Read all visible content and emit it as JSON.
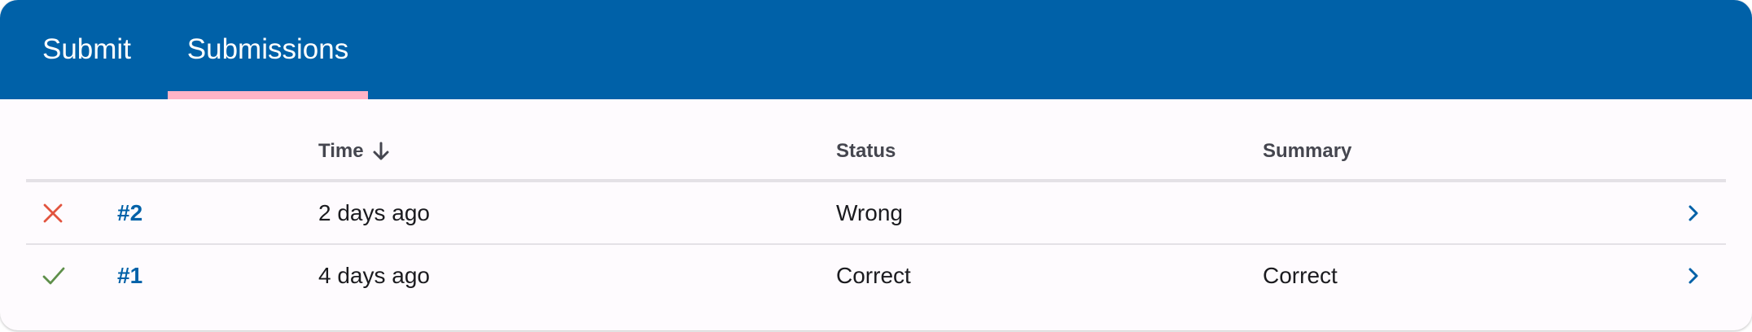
{
  "tabs": [
    {
      "label": "Submit",
      "selected": false
    },
    {
      "label": "Submissions",
      "selected": true
    }
  ],
  "colors": {
    "header": "#0061a8",
    "indicator": "#ffb3c6",
    "wrong": "#e2543f",
    "correct": "#5e8f4a",
    "link": "#0061a8"
  },
  "table": {
    "headers": {
      "time": "Time",
      "status": "Status",
      "summary": "Summary"
    },
    "sort_icon": "arrow-down-icon",
    "rows": [
      {
        "result_icon": "cross-icon",
        "id": "#2",
        "time": "2 days ago",
        "status": "Wrong",
        "summary": ""
      },
      {
        "result_icon": "check-icon",
        "id": "#1",
        "time": "4 days ago",
        "status": "Correct",
        "summary": "Correct"
      }
    ]
  }
}
